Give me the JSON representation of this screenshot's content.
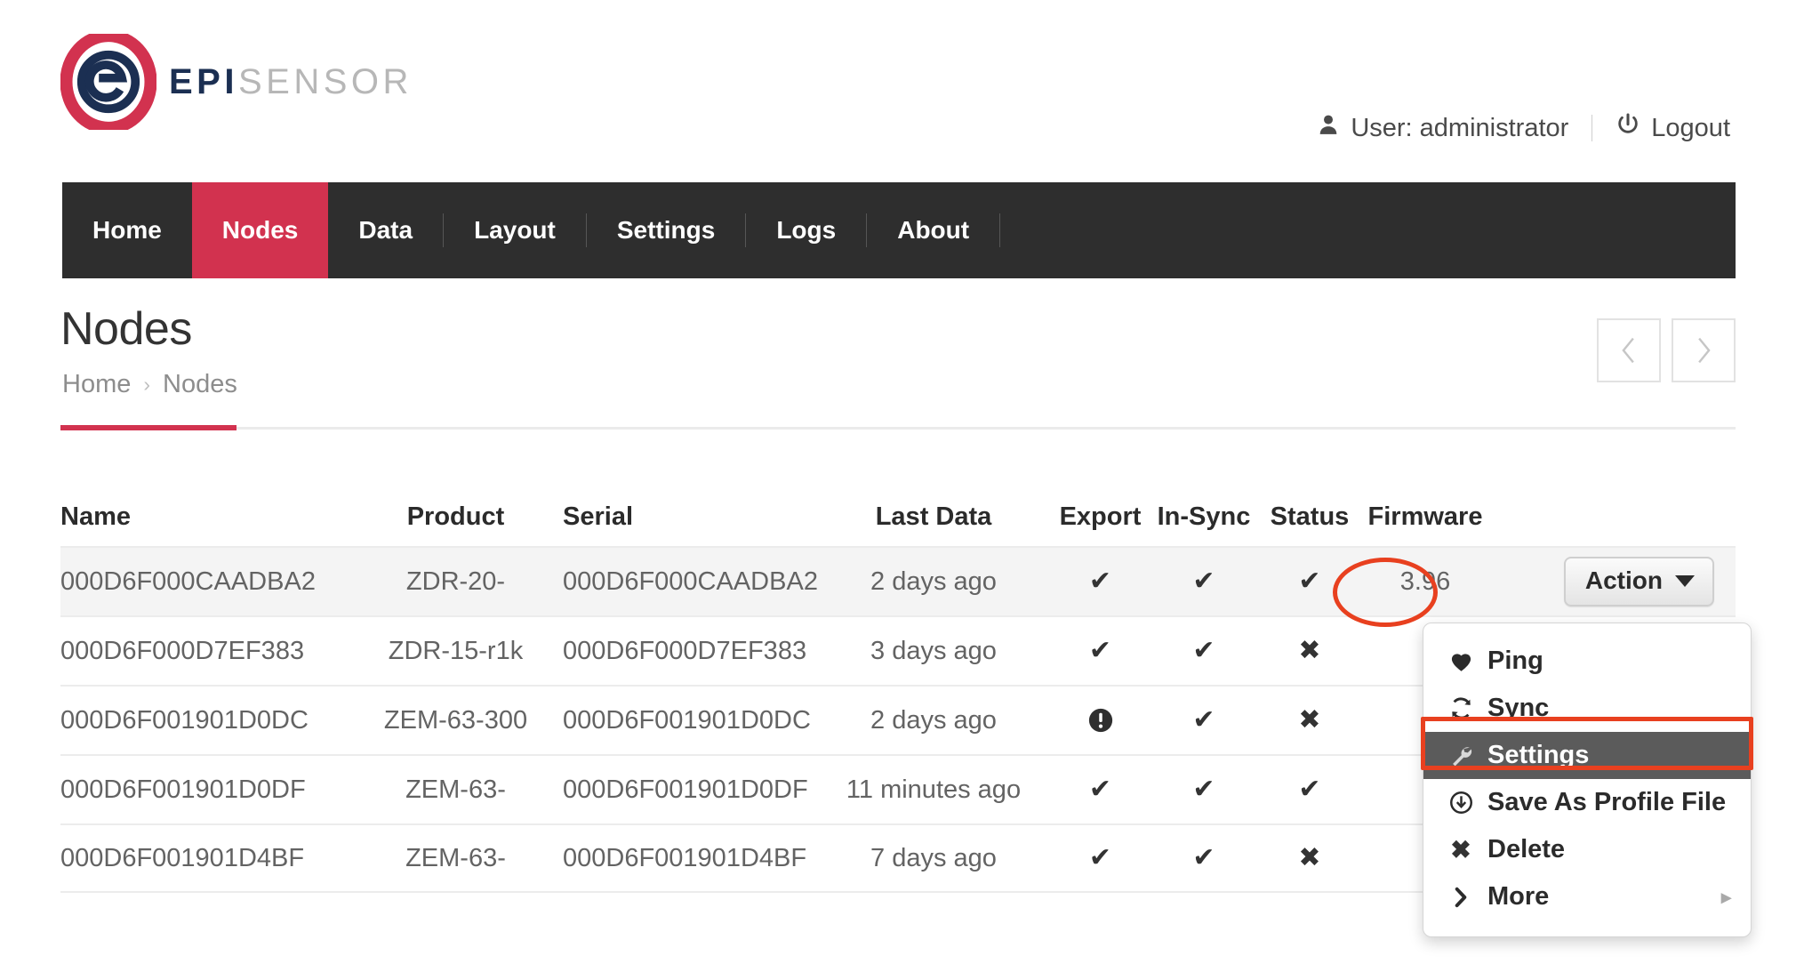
{
  "brand": {
    "epi": "EPI",
    "sensor": "SENSOR",
    "ring_color": "#d2324f",
    "mark_color": "#1b2f52"
  },
  "userbar": {
    "user_icon": "user-icon",
    "user_label": "User: administrator",
    "power_icon": "power-icon",
    "logout_label": "Logout"
  },
  "nav": {
    "active": "Nodes",
    "items": [
      {
        "label": "Home"
      },
      {
        "label": "Nodes"
      },
      {
        "label": "Data"
      },
      {
        "label": "Layout"
      },
      {
        "label": "Settings"
      },
      {
        "label": "Logs"
      },
      {
        "label": "About"
      }
    ]
  },
  "page": {
    "title": "Nodes",
    "breadcrumb": [
      "Home",
      "Nodes"
    ],
    "breadcrumb_separator": "›",
    "accent_color": "#d2324f"
  },
  "pager": {
    "prev_icon": "chevron-left-icon",
    "next_icon": "chevron-right-icon"
  },
  "table": {
    "headers": [
      "Name",
      "Product",
      "Serial",
      "Last Data",
      "Export",
      "In-Sync",
      "Status",
      "Firmware"
    ],
    "rows": [
      {
        "name": "000D6F000CAADBA2",
        "product": "ZDR-20-",
        "serial": "000D6F000CAADBA2",
        "last_data": "2 days ago",
        "export": "check",
        "in_sync": "check",
        "status": "check",
        "firmware": "3.96",
        "action_label": "Action"
      },
      {
        "name": "000D6F000D7EF383",
        "product": "ZDR-15-r1k",
        "serial": "000D6F000D7EF383",
        "last_data": "3 days ago",
        "export": "check",
        "in_sync": "check",
        "status": "cross",
        "firmware": "",
        "action_label": ""
      },
      {
        "name": "000D6F001901D0DC",
        "product": "ZEM-63-300",
        "serial": "000D6F001901D0DC",
        "last_data": "2 days ago",
        "export": "warning",
        "in_sync": "check",
        "status": "cross",
        "firmware": "",
        "action_label": ""
      },
      {
        "name": "000D6F001901D0DF",
        "product": "ZEM-63-",
        "serial": "000D6F001901D0DF",
        "last_data": "11 minutes ago",
        "export": "check",
        "in_sync": "check",
        "status": "check",
        "firmware": "",
        "action_label": ""
      },
      {
        "name": "000D6F001901D4BF",
        "product": "ZEM-63-",
        "serial": "000D6F001901D4BF",
        "last_data": "7 days ago",
        "export": "check",
        "in_sync": "check",
        "status": "cross",
        "firmware": "",
        "action_label": ""
      }
    ]
  },
  "action_menu": {
    "selected": "Settings",
    "items": [
      {
        "label": "Ping",
        "icon": "heart-icon"
      },
      {
        "label": "Sync",
        "icon": "sync-icon"
      },
      {
        "label": "Settings",
        "icon": "wrench-icon"
      },
      {
        "label": "Save As Profile File",
        "icon": "download-circle-icon"
      },
      {
        "label": "Delete",
        "icon": "x-icon"
      },
      {
        "label": "More",
        "icon": "chevron-right-icon",
        "submenu": "▸"
      }
    ]
  },
  "annotations": {
    "color": "#e8401f",
    "ellipse_target": "status-check-row-1",
    "box_target": "menu-item-settings"
  }
}
